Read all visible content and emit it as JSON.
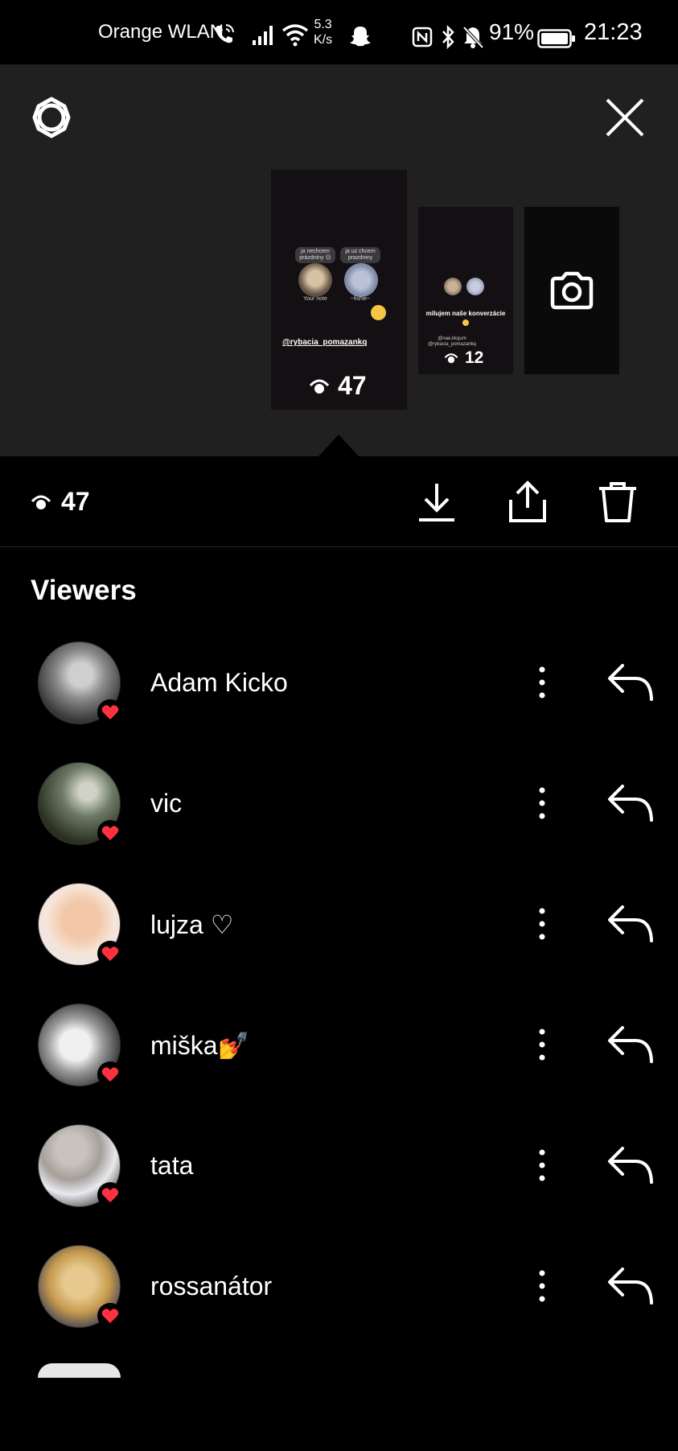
{
  "status_bar": {
    "carrier": "Orange WLAN",
    "speed_value": "5.3",
    "speed_unit": "K/s",
    "battery_percent": "91%",
    "time": "21:23"
  },
  "top_bar": {
    "settings_icon": "settings-icon",
    "close_icon": "close-icon"
  },
  "story_thumbnails": [
    {
      "notes": [
        "ja nechcem prázdniny 😑",
        "ja uz chcem prazdniny"
      ],
      "captions": [
        "Your note",
        "~fishie~"
      ],
      "mention": "@rybacia_pomazankq",
      "views": "47"
    },
    {
      "caption": "milujem naše konverzácie",
      "mention_1": "@nae.kkqum",
      "mention_2": "@rybacia_pomazankq",
      "views": "12"
    },
    {
      "icon": "camera-icon"
    }
  ],
  "action_bar": {
    "views": "47",
    "icons": [
      "download-icon",
      "share-icon",
      "trash-icon"
    ]
  },
  "viewers_title": "Viewers",
  "viewers": [
    {
      "name": "Adam Kicko",
      "reaction": "heart"
    },
    {
      "name": "vic",
      "reaction": "heart"
    },
    {
      "name": "lujza ♡",
      "reaction": "heart"
    },
    {
      "name": "miška💅",
      "reaction": "heart"
    },
    {
      "name": "tata",
      "reaction": "heart"
    },
    {
      "name": "rossanátor",
      "reaction": "heart"
    }
  ],
  "colors": {
    "background": "#000000",
    "preview_background": "#202020",
    "heart": "#ff3040",
    "text": "#ffffff"
  }
}
